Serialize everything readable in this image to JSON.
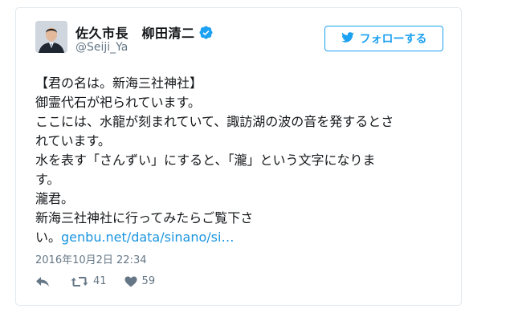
{
  "user": {
    "display_name": "佐久市長　柳田清二",
    "handle": "@Seiji_Ya",
    "verified": true
  },
  "follow_button": {
    "label": "フォローする",
    "icon": "twitter-bird-icon"
  },
  "tweet": {
    "lines": [
      "【君の名は。新海三社神社】",
      "御霊代石が祀られています。",
      "ここには、水龍が刻まれていて、諏訪湖の波の音を発するとさ",
      "れています。",
      "水を表す「さんずい」にすると、「瀧」という文字になりま",
      "す。",
      "瀧君。",
      "新海三社神社に行ってみたらご覧下さ"
    ],
    "last_line_prefix": "い。",
    "link_text": "genbu.net/data/sinano/si…"
  },
  "timestamp": "2016年10月2日 22:34",
  "actions": {
    "reply_icon": "reply-icon",
    "retweet_icon": "retweet-icon",
    "retweet_count": "41",
    "like_icon": "heart-icon",
    "like_count": "59"
  },
  "colors": {
    "accent": "#1da1f2",
    "link": "#1b95e0",
    "secondary_text": "#657786",
    "primary_text": "#14171a",
    "border": "#e1e8ed"
  }
}
